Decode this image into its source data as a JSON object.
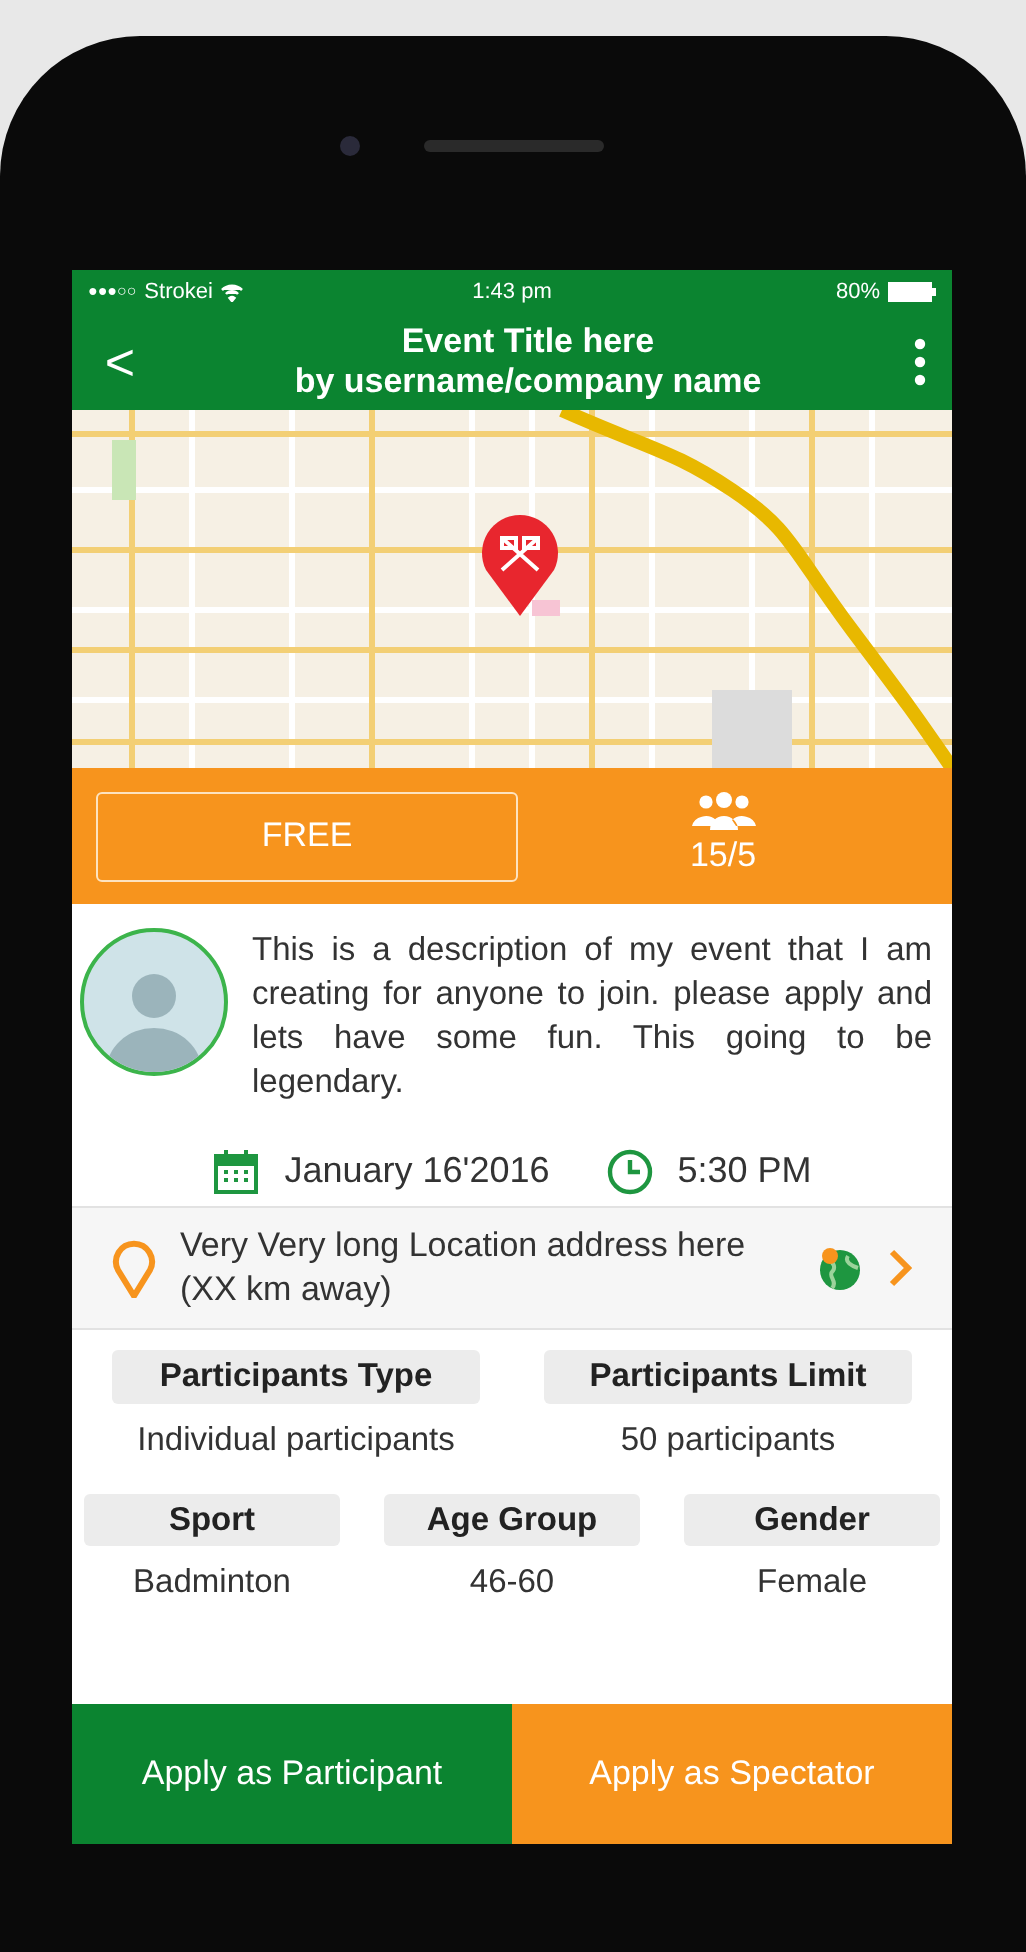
{
  "status_bar": {
    "signal_dots": "●●●○○",
    "carrier": "Strokei",
    "time": "1:43 pm",
    "battery": "80%"
  },
  "header": {
    "back": "<",
    "title": "Event Title here",
    "subtitle": "by username/company name"
  },
  "price_button": "FREE",
  "participants_count": "15/5",
  "description": "This is a description of my event that I am creating for anyone to join. please apply and lets have some fun. This going to be legendary.",
  "date": "January 16'2016",
  "time": "5:30 PM",
  "location": "Very Very long Location address here (XX km away)",
  "details_rows": [
    [
      {
        "label": "Participants Type",
        "value": "Individual participants"
      },
      {
        "label": "Participants Limit",
        "value": "50 participants"
      }
    ],
    [
      {
        "label": "Sport",
        "value": "Badminton"
      },
      {
        "label": "Age Group",
        "value": "46-60"
      },
      {
        "label": "Gender",
        "value": "Female"
      }
    ]
  ],
  "actions": [
    {
      "label": "Apply as Participant",
      "kind": "primary"
    },
    {
      "label": "Apply as Spectator",
      "kind": "secondary"
    }
  ]
}
